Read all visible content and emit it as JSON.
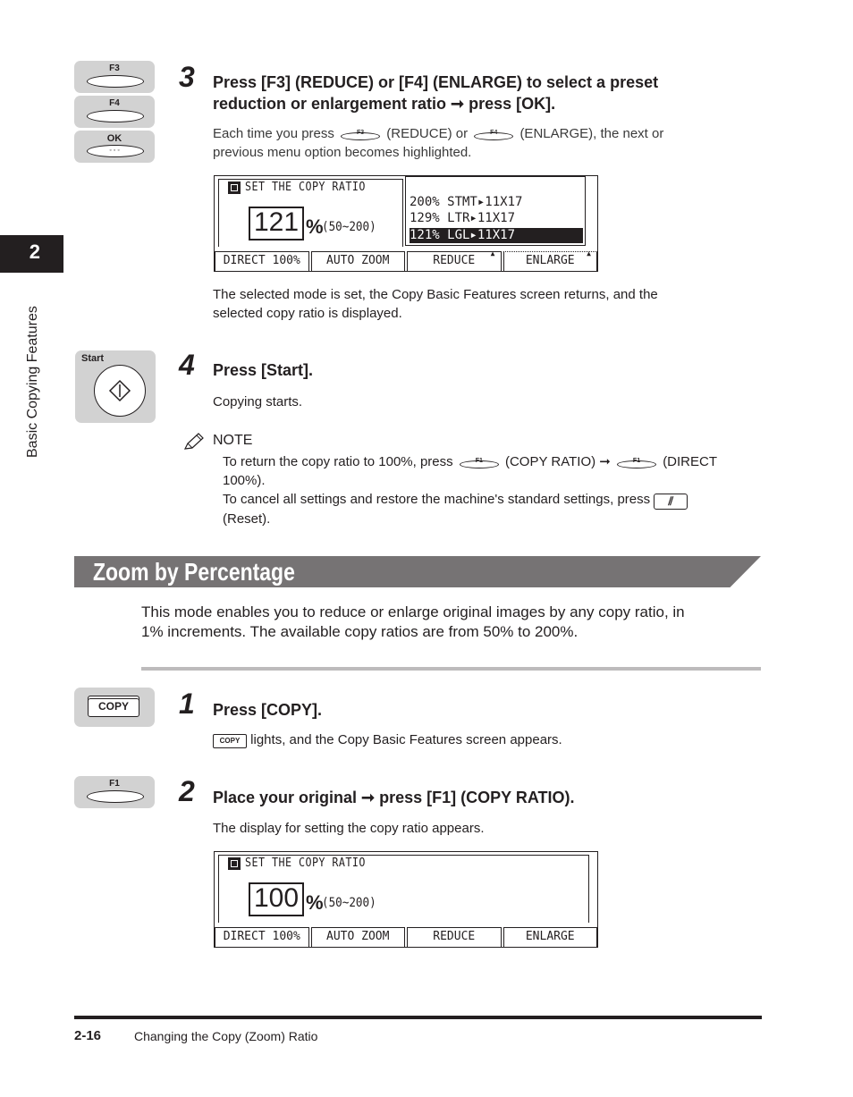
{
  "chapter_tab": {
    "number": "2",
    "label": "Basic Copying Features"
  },
  "steps_top": {
    "keys": {
      "f3": "F3",
      "f4": "F4",
      "ok": "OK",
      "ok_dots": "◦◦◦"
    },
    "step3": {
      "number": "3",
      "title_line1": "Press [F3] (REDUCE) or [F4] (ENLARGE) to select a preset",
      "title_line2": "reduction or enlargement ratio ➞ press [OK].",
      "body_a": "Each time you press",
      "key1": "F3",
      "body_b": "(REDUCE) or",
      "key2": "F4",
      "body_c": "(ENLARGE), the next or",
      "body_line2": "previous menu option becomes highlighted.",
      "after_text_line1": "The selected mode is set, the Copy Basic Features screen returns, and the",
      "after_text_line2": "selected copy ratio is displayed."
    },
    "lcd1": {
      "title": "SET THE COPY RATIO",
      "value": "121",
      "percent": "%",
      "range": "(50~200)",
      "list": [
        {
          "text": "200% STMT▸11X17",
          "selected": false
        },
        {
          "text": "129% LTR▸11X17",
          "selected": false
        },
        {
          "text": "121% LGL▸11X17",
          "selected": true
        }
      ],
      "buttons": [
        "DIRECT 100%",
        "AUTO ZOOM",
        "REDUCE",
        "ENLARGE"
      ]
    },
    "step4": {
      "key_label": "Start",
      "number": "4",
      "title": "Press [Start].",
      "body": "Copying starts."
    },
    "note": {
      "heading": "NOTE",
      "line1_a": "To return the copy ratio to 100%, press",
      "key1": "F1",
      "line1_b": "(COPY RATIO) ➞",
      "key2": "F1",
      "line1_c": "(DIRECT",
      "line1_d": "100%).",
      "line2_a": "To cancel all settings and restore the machine's standard settings, press",
      "reset_glyph": "⫽",
      "line2_b": "(Reset)."
    }
  },
  "section": {
    "title": "Zoom by Percentage",
    "intro_line1": "This mode enables you to reduce or enlarge original images by any copy ratio, in",
    "intro_line2": "1% increments. The available copy ratios are from 50% to 200%.",
    "step1": {
      "key_label": "COPY",
      "number": "1",
      "title": "Press [COPY].",
      "inline_key": "COPY",
      "body": "lights, and the Copy Basic Features screen appears."
    },
    "step2": {
      "key_label": "F1",
      "number": "2",
      "title": "Place your original ➞ press [F1] (COPY RATIO).",
      "body": "The display for setting the copy ratio appears."
    },
    "lcd2": {
      "title": "SET THE COPY RATIO",
      "value": "100",
      "percent": "%",
      "range": "(50~200)",
      "buttons": [
        "DIRECT 100%",
        "AUTO ZOOM",
        "REDUCE",
        "ENLARGE"
      ]
    }
  },
  "footer": {
    "page_number": "2-16",
    "section_title": "Changing the Copy (Zoom) Ratio"
  }
}
